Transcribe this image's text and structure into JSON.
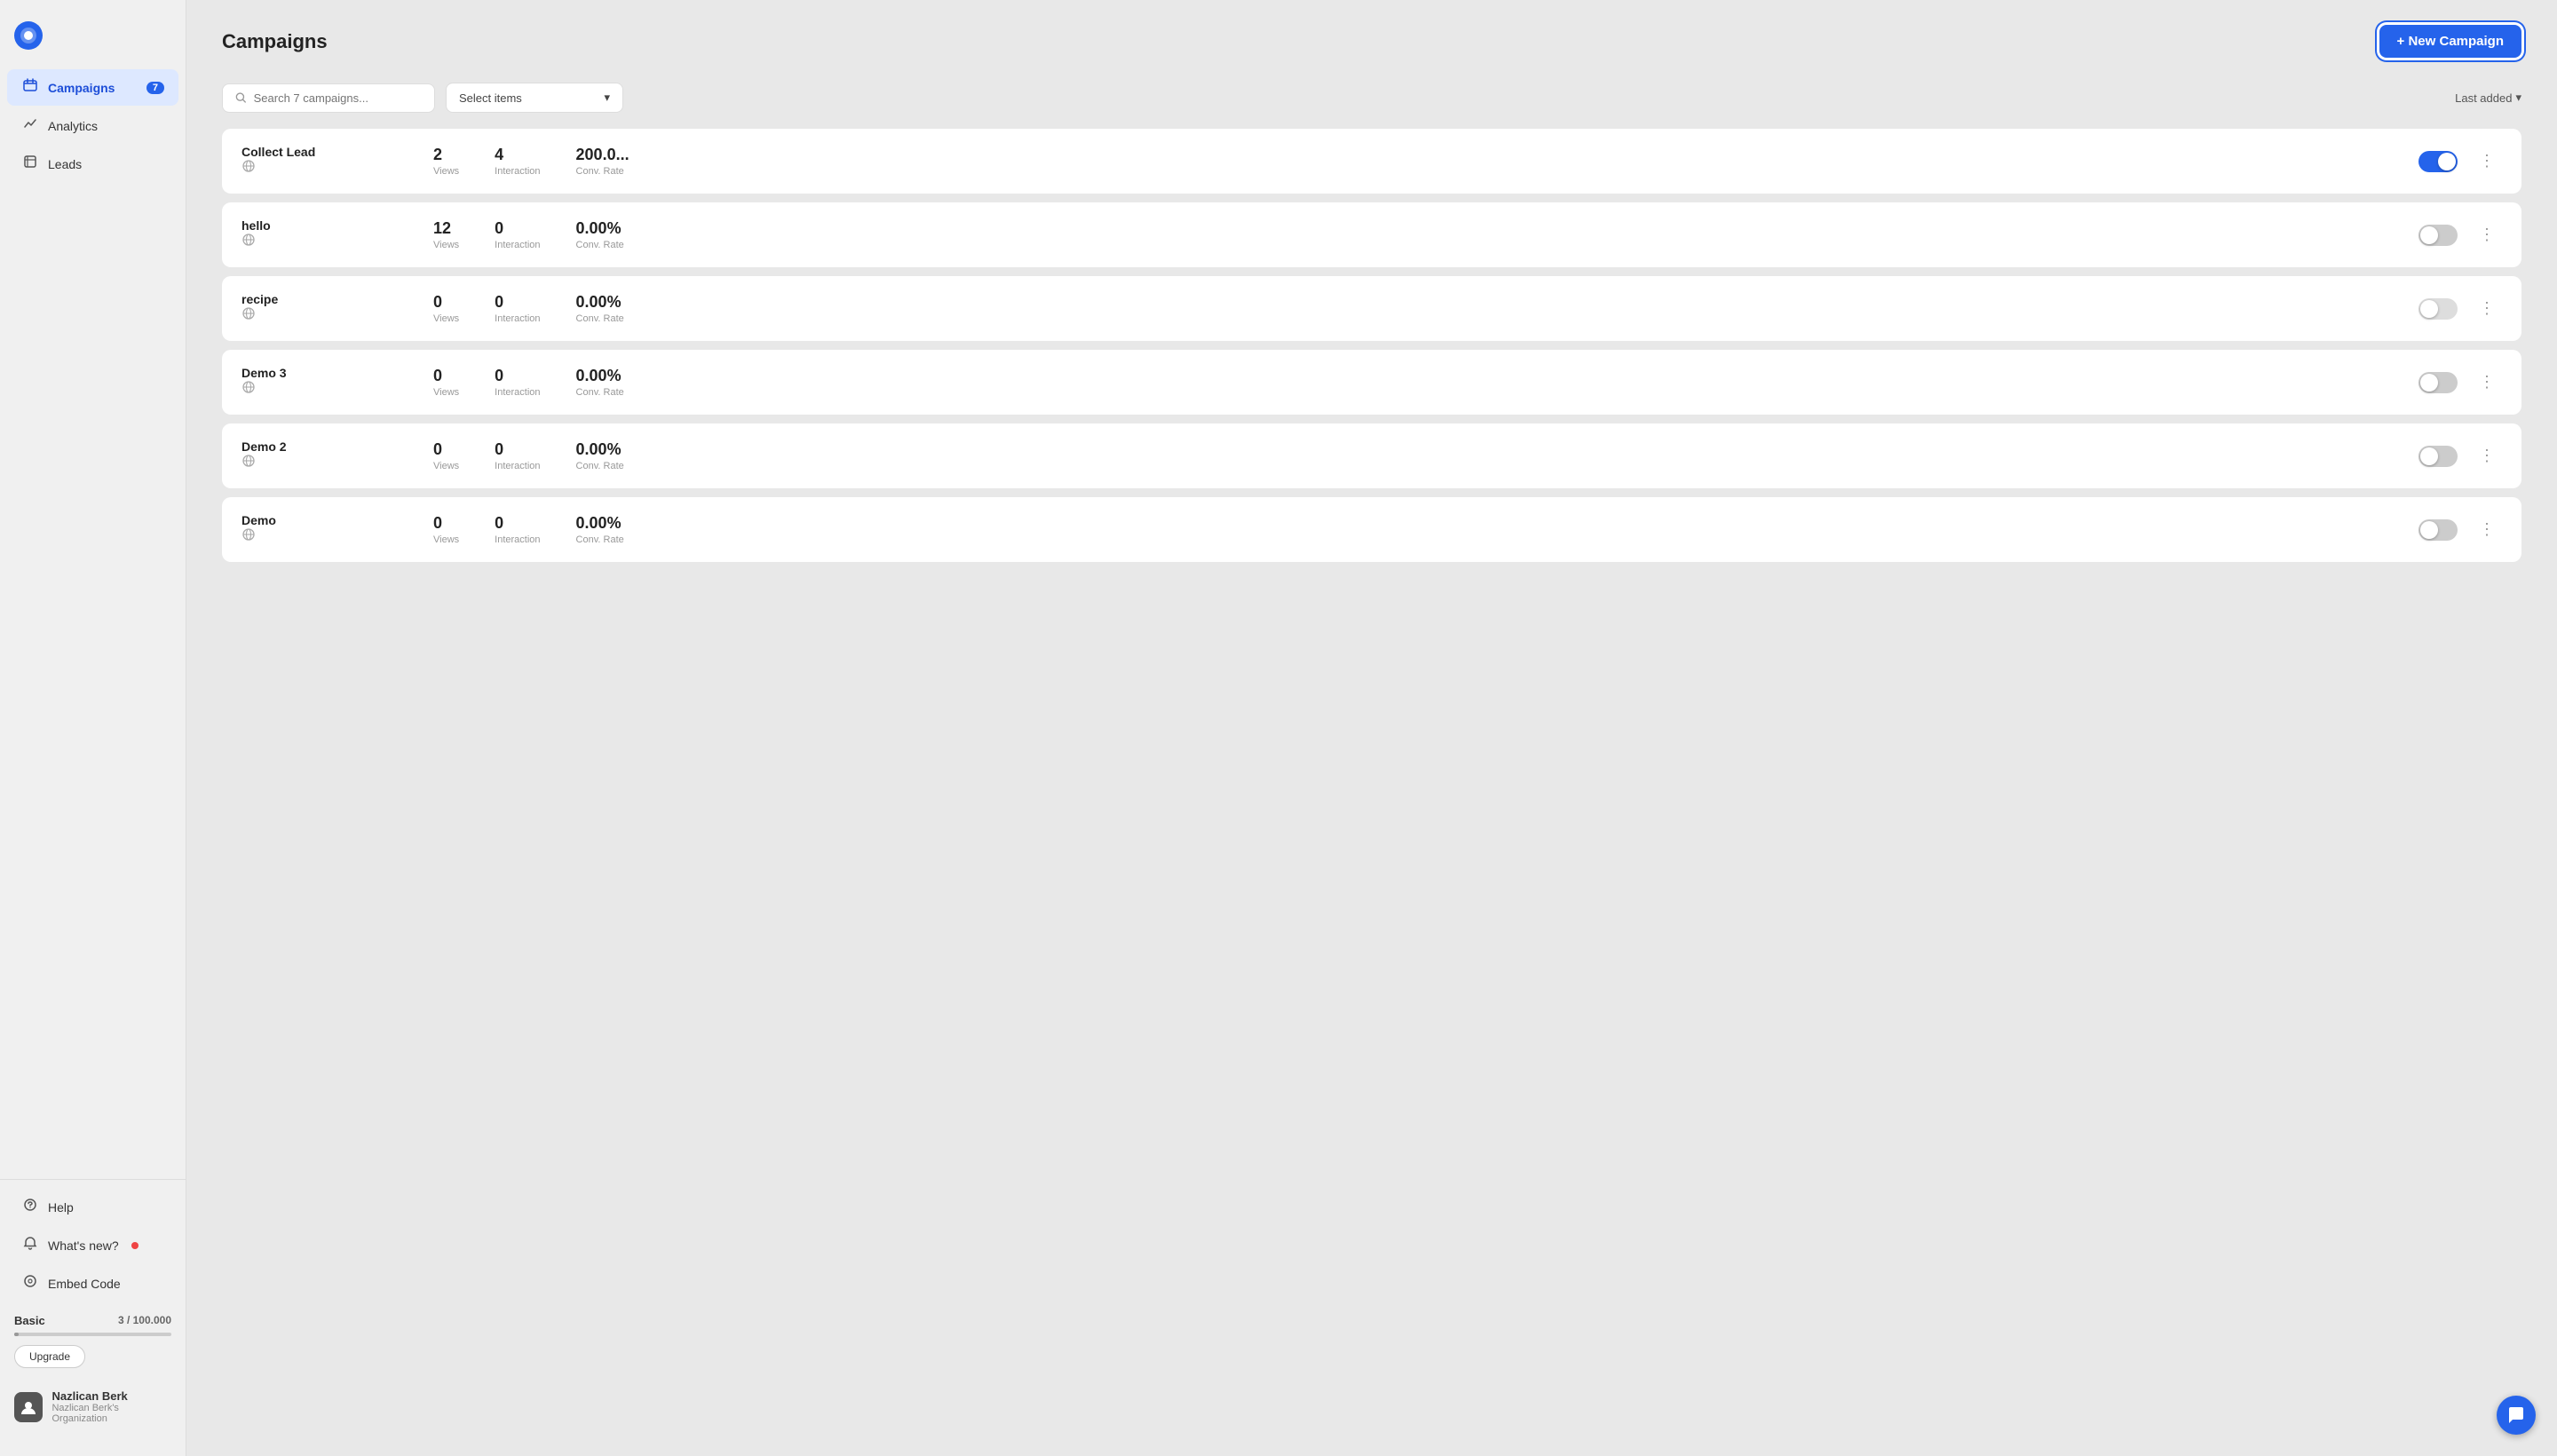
{
  "app": {
    "logo": "Q"
  },
  "sidebar": {
    "nav_items": [
      {
        "id": "campaigns",
        "label": "Campaigns",
        "icon": "📁",
        "badge": "7",
        "active": true
      },
      {
        "id": "analytics",
        "label": "Analytics",
        "icon": "↗",
        "badge": null,
        "active": false
      },
      {
        "id": "leads",
        "label": "Leads",
        "icon": "📋",
        "badge": null,
        "active": false
      }
    ],
    "bottom_items": [
      {
        "id": "help",
        "label": "Help",
        "icon": "?"
      },
      {
        "id": "whats-new",
        "label": "What's new?",
        "icon": "🔔",
        "dot": true
      },
      {
        "id": "embed-code",
        "label": "Embed Code",
        "icon": "⊙"
      }
    ],
    "plan": {
      "name": "Basic",
      "current": "3",
      "max": "100.000",
      "display": "3 / 100.000"
    },
    "upgrade_label": "Upgrade",
    "user": {
      "name": "Nazlican Berk",
      "org": "Nazlican Berk's Organization",
      "avatar": "👤"
    }
  },
  "header": {
    "title": "Campaigns",
    "new_campaign_label": "+ New Campaign"
  },
  "toolbar": {
    "search_placeholder": "Search 7 campaigns...",
    "select_placeholder": "Select items",
    "sort_label": "Last added",
    "sort_icon": "▾"
  },
  "campaigns": [
    {
      "name": "Collect Lead",
      "views": "2",
      "views_label": "Views",
      "interaction": "4",
      "interaction_label": "Interaction",
      "conv_rate": "200.0...",
      "conv_rate_label": "Conv. Rate",
      "enabled": true,
      "disabled_style": false
    },
    {
      "name": "hello",
      "views": "12",
      "views_label": "Views",
      "interaction": "0",
      "interaction_label": "Interaction",
      "conv_rate": "0.00%",
      "conv_rate_label": "Conv. Rate",
      "enabled": false,
      "disabled_style": false
    },
    {
      "name": "recipe",
      "views": "0",
      "views_label": "Views",
      "interaction": "0",
      "interaction_label": "Interaction",
      "conv_rate": "0.00%",
      "conv_rate_label": "Conv. Rate",
      "enabled": false,
      "disabled_style": true
    },
    {
      "name": "Demo 3",
      "views": "0",
      "views_label": "Views",
      "interaction": "0",
      "interaction_label": "Interaction",
      "conv_rate": "0.00%",
      "conv_rate_label": "Conv. Rate",
      "enabled": false,
      "disabled_style": false
    },
    {
      "name": "Demo 2",
      "views": "0",
      "views_label": "Views",
      "interaction": "0",
      "interaction_label": "Interaction",
      "conv_rate": "0.00%",
      "conv_rate_label": "Conv. Rate",
      "enabled": false,
      "disabled_style": false
    },
    {
      "name": "Demo",
      "views": "0",
      "views_label": "Views",
      "interaction": "0",
      "interaction_label": "Interaction",
      "conv_rate": "0.00%",
      "conv_rate_label": "Conv. Rate",
      "enabled": false,
      "disabled_style": false
    }
  ]
}
